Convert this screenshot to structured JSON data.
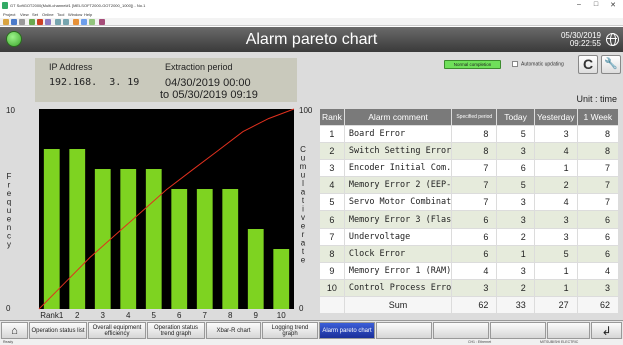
{
  "window": {
    "title": "GT SoftGOT2000(Multi-channel#1 [MELSOFT2000-GOT2000_1000]) - No.1",
    "minimize_glyph": "–",
    "maximize_glyph": "□",
    "close_glyph": "✕"
  },
  "menu": [
    "Project",
    "View",
    "Set",
    "Online",
    "Tool",
    "Window",
    "Help"
  ],
  "header": {
    "title": "Alarm pareto chart",
    "date": "05/30/2019",
    "time": "09:22:55",
    "globe_icon": "globe-icon"
  },
  "info": {
    "ip_label": "IP Address",
    "ip_value": "192.168.  3. 19",
    "period_label": "Extraction period",
    "period_from": "04/30/2019 00:00",
    "period_to": "to 05/30/2019 09:19"
  },
  "status": {
    "completion": "Normal completion",
    "auto_update": "Automatic updating",
    "refresh_glyph": "C",
    "settings_glyph": "🔧"
  },
  "unit": "Unit : time",
  "chart_data": {
    "type": "bar",
    "categories": [
      "Rank1",
      "2",
      "3",
      "4",
      "5",
      "6",
      "7",
      "8",
      "9",
      "10"
    ],
    "values": [
      8,
      8,
      7,
      7,
      7,
      6,
      6,
      6,
      4,
      3
    ],
    "cumulative_percent": [
      12.9,
      25.8,
      37.1,
      48.4,
      59.7,
      69.4,
      79.0,
      88.7,
      95.2,
      100
    ],
    "ylim": [
      0,
      10
    ],
    "y2lim": [
      0,
      100
    ],
    "y_ticks": [
      "10",
      "0"
    ],
    "y2_ticks": [
      "100",
      "0"
    ],
    "ylabel": "Frequency",
    "y2label": "Cumulative rate",
    "colors": {
      "bar": "#7ed321",
      "line": "#e0301e",
      "background": "#000000"
    }
  },
  "table": {
    "headers": [
      "Rank",
      "Alarm comment",
      "Specified period",
      "Today",
      "Yesterday",
      "1 Week"
    ],
    "rows": [
      [
        "1",
        "Board Error",
        "8",
        "5",
        "3",
        "8"
      ],
      [
        "2",
        "Switch Setting Error",
        "8",
        "3",
        "4",
        "8"
      ],
      [
        "3",
        "Encoder Initial Com.",
        "7",
        "6",
        "1",
        "7"
      ],
      [
        "4",
        "Memory Error 2 (EEP-",
        "7",
        "5",
        "2",
        "7"
      ],
      [
        "5",
        "Servo Motor Combinat",
        "7",
        "3",
        "4",
        "7"
      ],
      [
        "6",
        "Memory Error 3 (Flas",
        "6",
        "3",
        "3",
        "6"
      ],
      [
        "7",
        "Undervoltage",
        "6",
        "2",
        "3",
        "6"
      ],
      [
        "8",
        "Clock Error",
        "6",
        "1",
        "5",
        "6"
      ],
      [
        "9",
        "Memory Error 1 (RAM)",
        "4",
        "3",
        "1",
        "4"
      ],
      [
        "10",
        "Control Process Erro",
        "3",
        "2",
        "1",
        "3"
      ]
    ],
    "sum_label": "Sum",
    "sums": [
      "62",
      "33",
      "27",
      "62"
    ]
  },
  "nav": {
    "home_icon": "home-icon",
    "buttons": [
      "Operation status list",
      "Overall equipment efficiency",
      "Operation status trend graph",
      "Xbar-R chart",
      "Logging trend graph",
      "Alarm pareto chart"
    ],
    "return_glyph": "↲"
  },
  "statusbar": {
    "left": "Ready",
    "ch": "CH1 : Ethernet",
    "maker": "MITSUBISHI ELECTRIC"
  }
}
